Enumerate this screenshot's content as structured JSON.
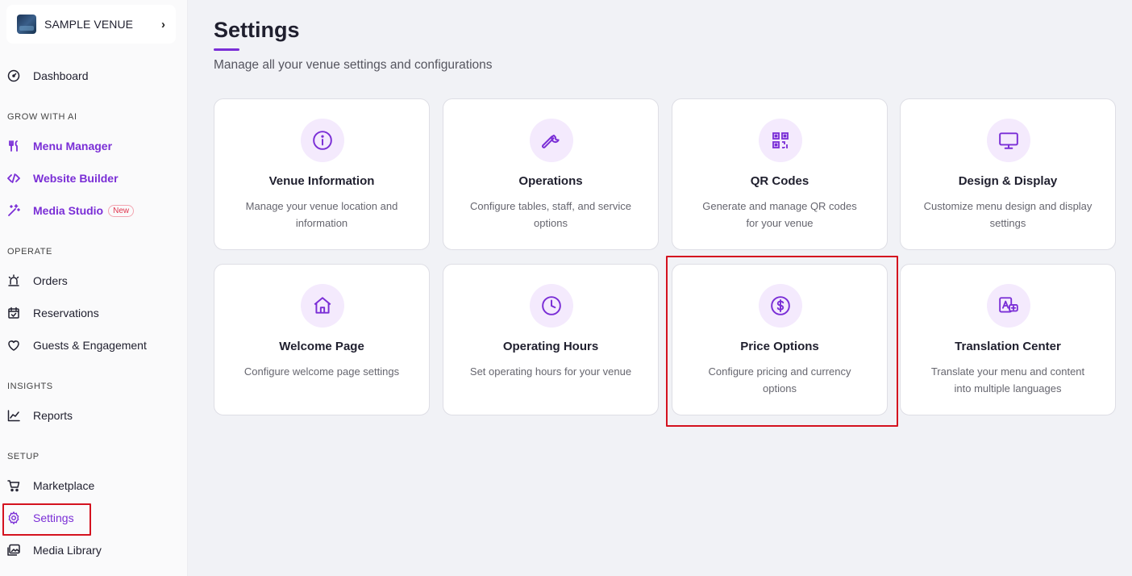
{
  "venue": {
    "name": "SAMPLE VENUE"
  },
  "sidebar": {
    "dashboard": "Dashboard",
    "sections": {
      "grow": "GROW WITH AI",
      "operate": "OPERATE",
      "insights": "INSIGHTS",
      "setup": "SETUP"
    },
    "grow_items": [
      {
        "label": "Menu Manager"
      },
      {
        "label": "Website Builder"
      },
      {
        "label": "Media Studio",
        "badge": "New"
      }
    ],
    "operate_items": [
      {
        "label": "Orders"
      },
      {
        "label": "Reservations"
      },
      {
        "label": "Guests & Engagement"
      }
    ],
    "insights_items": [
      {
        "label": "Reports"
      }
    ],
    "setup_items": [
      {
        "label": "Marketplace"
      },
      {
        "label": "Settings"
      },
      {
        "label": "Media Library"
      }
    ]
  },
  "header": {
    "title": "Settings",
    "subtitle": "Manage all your venue settings and configurations"
  },
  "cards": [
    {
      "title": "Venue Information",
      "desc": "Manage your venue location and information",
      "icon": "info-icon"
    },
    {
      "title": "Operations",
      "desc": "Configure tables, staff, and service options",
      "icon": "wrench-icon"
    },
    {
      "title": "QR Codes",
      "desc": "Generate and manage QR codes for your venue",
      "icon": "qr-code-icon"
    },
    {
      "title": "Design & Display",
      "desc": "Customize menu design and display settings",
      "icon": "monitor-icon"
    },
    {
      "title": "Welcome Page",
      "desc": "Configure welcome page settings",
      "icon": "home-icon"
    },
    {
      "title": "Operating Hours",
      "desc": "Set operating hours for your venue",
      "icon": "clock-icon"
    },
    {
      "title": "Price Options",
      "desc": "Configure pricing and currency options",
      "icon": "dollar-circle-icon"
    },
    {
      "title": "Translation Center",
      "desc": "Translate your menu and content into multiple languages",
      "icon": "translate-icon"
    }
  ],
  "colors": {
    "accent": "#7a2ed6",
    "highlight": "#d4121f",
    "icon_bg": "#f4eafd",
    "badge": "#e0364f"
  }
}
